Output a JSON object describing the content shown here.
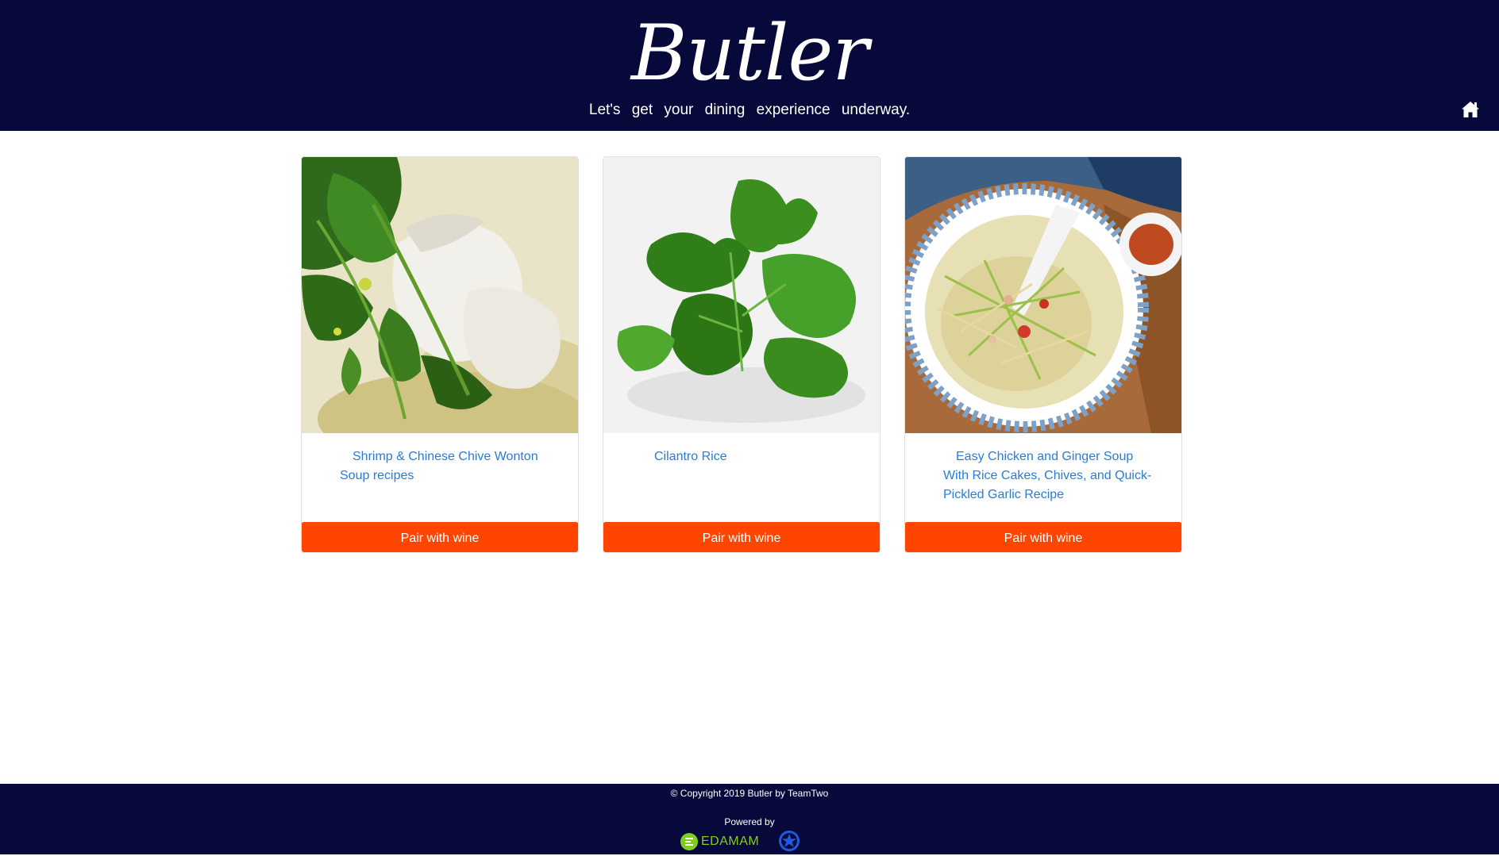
{
  "header": {
    "brand": "Butler",
    "tagline": "Let's get your dining experience underway.",
    "home_icon": "home-icon",
    "background": "#08093b"
  },
  "recipes": [
    {
      "title": "Shrimp & Chinese Chive Wonton Soup recipes",
      "image_icon": "wonton-soup-photo",
      "button_label": "Pair with wine"
    },
    {
      "title": "Cilantro Rice",
      "image_icon": "cilantro-photo",
      "button_label": "Pair with wine"
    },
    {
      "title": "Easy Chicken and Ginger Soup With Rice Cakes, Chives, and Quick-Pickled Garlic Recipe",
      "image_icon": "ginger-soup-photo",
      "button_label": "Pair with wine"
    }
  ],
  "colors": {
    "accent": "#ff4500",
    "link": "#2a7bd7",
    "edamam_green": "#7ccf1f",
    "navy": "#08093b"
  },
  "footer": {
    "copyright": "© Copyright 2019 Butler by TeamTwo",
    "powered_by": "Powered by",
    "edamam_label": "EDAMAM",
    "edamam_icon": "edamam-logo-icon",
    "partner_icon": "star-badge-icon"
  }
}
